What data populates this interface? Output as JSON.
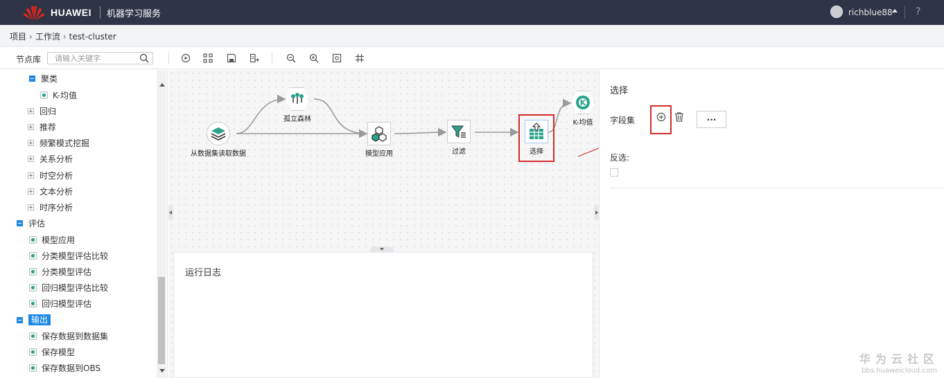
{
  "header": {
    "brand": "HUAWEI",
    "service": "机器学习服务",
    "user": "richblue88",
    "help": "?"
  },
  "breadcrumb": [
    "项目",
    "工作流",
    "test-cluster"
  ],
  "toolbar": {
    "library_label": "节点库",
    "search_placeholder": "请输入关键字",
    "buttons": [
      "run-icon",
      "layout-icon",
      "save-icon",
      "export-icon",
      "zoom-out-icon",
      "zoom-in-icon",
      "fit-icon",
      "grid-icon"
    ]
  },
  "sidebar": {
    "items": [
      {
        "label": "聚类",
        "level": 1,
        "state": "expanded"
      },
      {
        "label": "K-均值",
        "level": 2
      },
      {
        "label": "回归",
        "level": 1,
        "state": "collapsed"
      },
      {
        "label": "推荐",
        "level": 1,
        "state": "collapsed"
      },
      {
        "label": "频繁模式挖掘",
        "level": 1,
        "state": "collapsed"
      },
      {
        "label": "关系分析",
        "level": 1,
        "state": "collapsed"
      },
      {
        "label": "时空分析",
        "level": 1,
        "state": "collapsed"
      },
      {
        "label": "文本分析",
        "level": 1,
        "state": "collapsed"
      },
      {
        "label": "时序分析",
        "level": 1,
        "state": "collapsed"
      },
      {
        "label": "评估",
        "level": 0,
        "state": "expanded"
      },
      {
        "label": "模型应用",
        "level": 1
      },
      {
        "label": "分类模型评估比较",
        "level": 1
      },
      {
        "label": "分类模型评估",
        "level": 1
      },
      {
        "label": "回归模型评估比较",
        "level": 1
      },
      {
        "label": "回归模型评估",
        "level": 1
      },
      {
        "label": "输出",
        "level": 0,
        "state": "expanded",
        "selected": true
      },
      {
        "label": "保存数据到数据集",
        "level": 1
      },
      {
        "label": "保存模型",
        "level": 1
      },
      {
        "label": "保存数据到OBS",
        "level": 1
      }
    ]
  },
  "workflow": {
    "nodes": [
      {
        "id": "read",
        "label": "从数据集读取数据",
        "icon": "layers-icon"
      },
      {
        "id": "rf",
        "label": "孤立森林",
        "icon": "tree-icon"
      },
      {
        "id": "apply",
        "label": "模型应用",
        "icon": "cubes-icon"
      },
      {
        "id": "filter",
        "label": "过滤",
        "icon": "filter-icon"
      },
      {
        "id": "select",
        "label": "选择",
        "icon": "table-select-icon",
        "selected": true
      },
      {
        "id": "kmeans",
        "label": "K-均值",
        "icon": "kmeans-icon"
      }
    ]
  },
  "log_panel": {
    "title": "运行日志"
  },
  "properties": {
    "title": "选择",
    "field_set_label": "字段集",
    "more_label": "···",
    "invert_label": "反选:",
    "invert_checked": false
  },
  "watermark": {
    "main": "华为云社区",
    "sub": "bbs.huaweicloud.com"
  },
  "colors": {
    "header_bg": "#2f3446",
    "accent": "#1e88e5",
    "highlight_border": "#d42a2a",
    "node_teal": "#29a38a"
  }
}
